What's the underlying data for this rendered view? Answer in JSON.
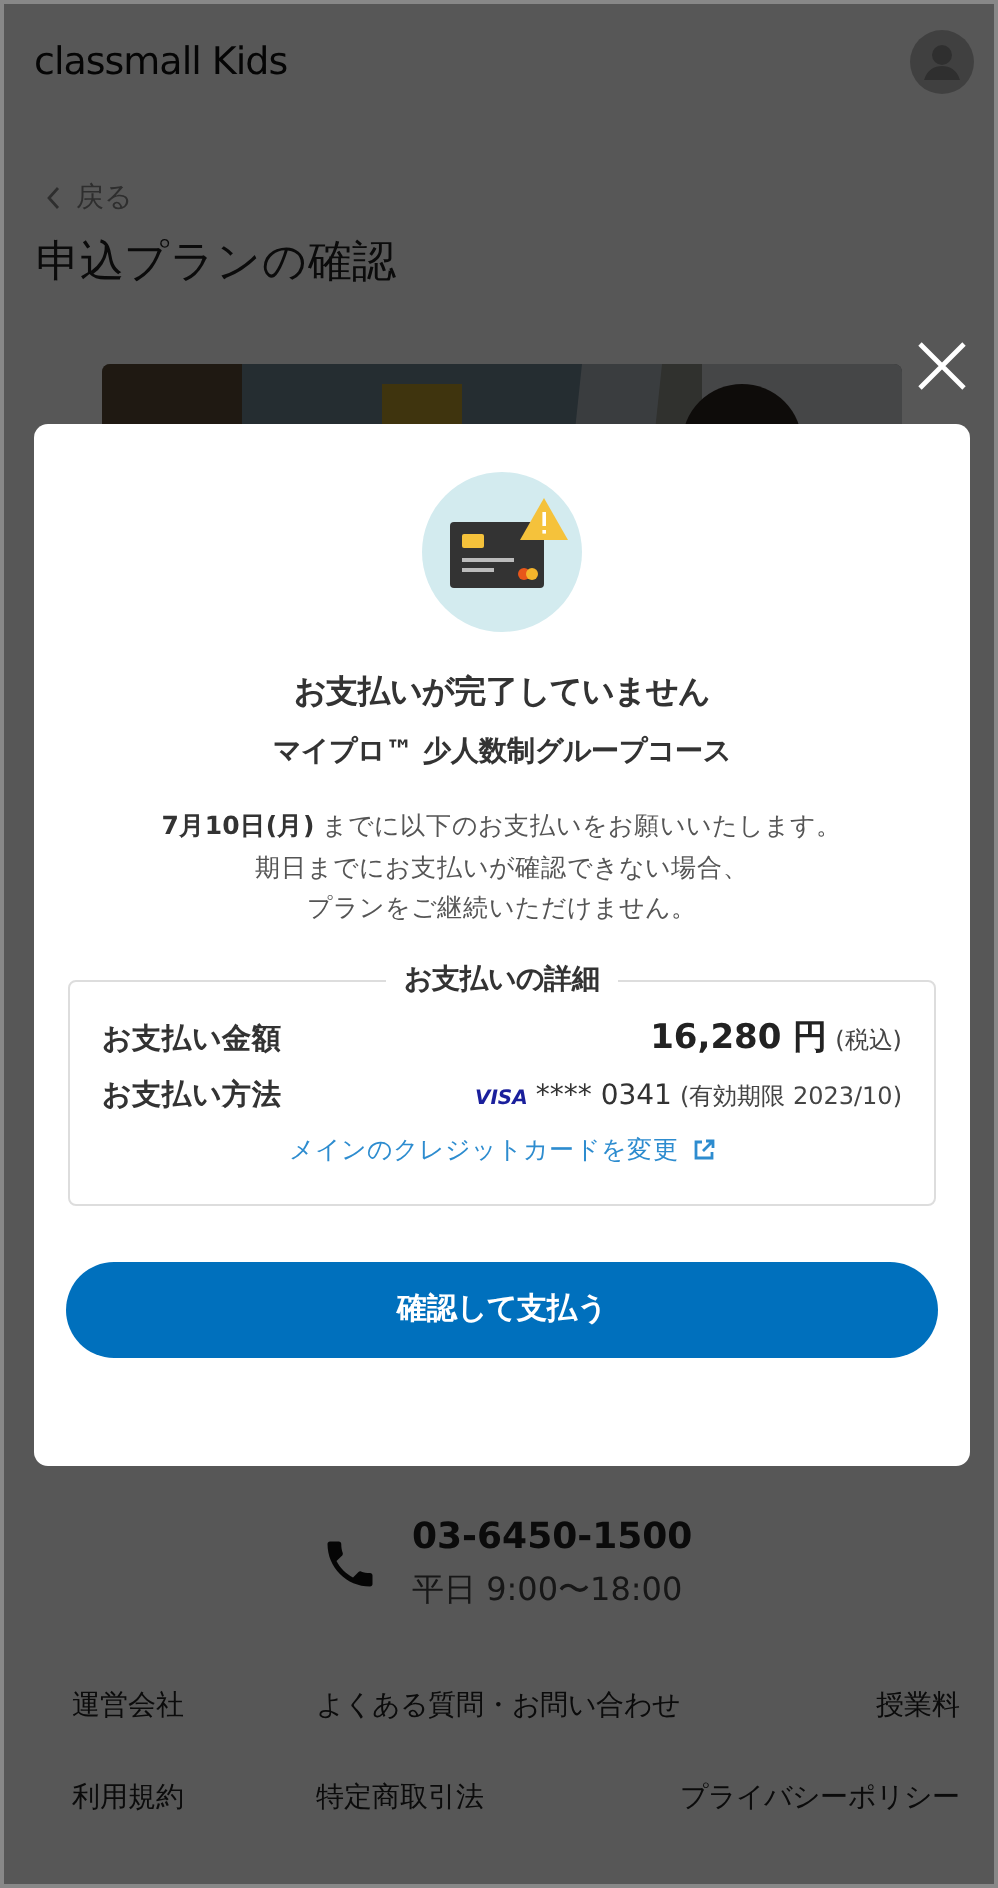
{
  "header": {
    "logo": "classmall Kids"
  },
  "back_link": {
    "label": "戻る"
  },
  "page_title": "申込プランの確認",
  "contact": {
    "phone": "03-6450-1500",
    "hours": "平日 9:00〜18:00"
  },
  "footer_links": [
    "運営会社",
    "よくある質問・お問い合わせ",
    "授業料",
    "利用規約",
    "特定商取引法",
    "プライバシーポリシー"
  ],
  "modal": {
    "title": "お支払いが完了していません",
    "course": "マイプロ™ 少人数制グループコース",
    "message_lines": [
      "**7月10日(月)** までに以下のお支払いをお願いいたします。",
      "期日までにお支払いが確認できない場合、",
      "プランをご継続いただけません。"
    ],
    "details": {
      "legend": "お支払いの詳細",
      "amount": {
        "label": "お支払い金額",
        "value": "16,280 円",
        "note": "(税込)"
      },
      "method": {
        "label": "お支払い方法",
        "brand": "VISA",
        "card": "**** 0341",
        "expiry": "(有効期限 2023/10)"
      },
      "change_link": "メインのクレジットカードを変更"
    },
    "button": "確認して支払う"
  }
}
